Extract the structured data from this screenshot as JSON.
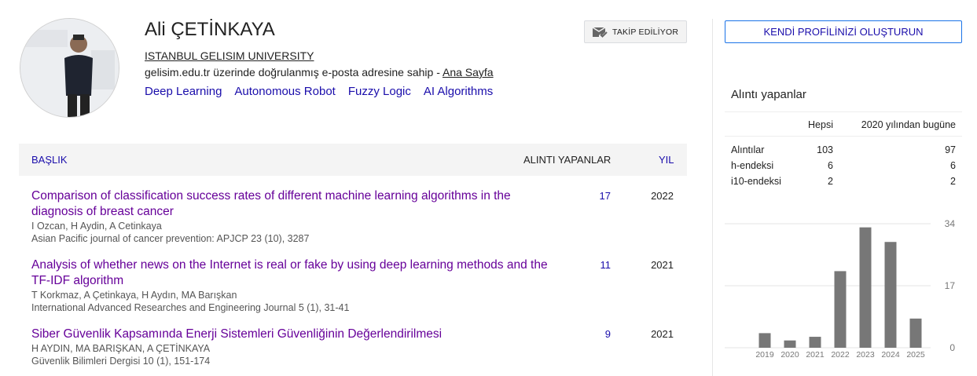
{
  "profile": {
    "name": "Ali ÇETİNKAYA",
    "affiliation": "ISTANBUL GELISIM UNIVERSITY",
    "verified_text": "gelisim.edu.tr üzerinde doğrulanmış e-posta adresine sahip - ",
    "homepage_label": "Ana Sayfa",
    "interests": [
      "Deep Learning",
      "Autonomous Robot",
      "Fuzzy Logic",
      "AI Algorithms"
    ],
    "follow_label": "TAKİP EDİLİYOR",
    "avatar_icon": "profile-photo"
  },
  "sidebar": {
    "create_profile_label": "KENDİ PROFİLİNİZİ OLUŞTURUN",
    "cited_by_title": "Alıntı yapanlar",
    "col_all": "Hepsi",
    "col_since": "2020 yılından bugüne",
    "rows": [
      {
        "label": "Alıntılar",
        "all": "103",
        "since": "97"
      },
      {
        "label": "h-endeksi",
        "all": "6",
        "since": "6"
      },
      {
        "label": "i10-endeksi",
        "all": "2",
        "since": "2"
      }
    ]
  },
  "table": {
    "header_title": "BAŞLIK",
    "header_cited": "ALINTI YAPANLAR",
    "header_year": "YIL",
    "rows": [
      {
        "title": "Comparison of classification success rates of different machine learning algorithms in the diagnosis of breast cancer",
        "authors": "I Ozcan, H Aydin, A Cetinkaya",
        "venue": "Asian Pacific journal of cancer prevention: APJCP 23 (10), 3287",
        "cites": "17",
        "year": "2022"
      },
      {
        "title": "Analysis of whether news on the Internet is real or fake by using deep learning methods and the TF-IDF algorithm",
        "authors": "T Korkmaz, A Çetinkaya, H Aydın, MA Barışkan",
        "venue": "International Advanced Researches and Engineering Journal 5 (1), 31-41",
        "cites": "11",
        "year": "2021"
      },
      {
        "title": "Siber Güvenlik Kapsamında Enerji Sistemleri Güvenliğinin Değerlendirilmesi",
        "authors": "H AYDIN, MA BARIŞKAN, A ÇETİNKAYA",
        "venue": "Güvenlik Bilimleri Dergisi 10 (1), 151-174",
        "cites": "9",
        "year": "2021"
      }
    ]
  },
  "chart_data": {
    "type": "bar",
    "categories": [
      "2019",
      "2020",
      "2021",
      "2022",
      "2023",
      "2024",
      "2025"
    ],
    "values": [
      4,
      2,
      3,
      21,
      33,
      29,
      8
    ],
    "ylim": [
      0,
      34
    ],
    "yticks": [
      "0",
      "17",
      "34"
    ],
    "bar_color": "#777777",
    "grid": true
  }
}
